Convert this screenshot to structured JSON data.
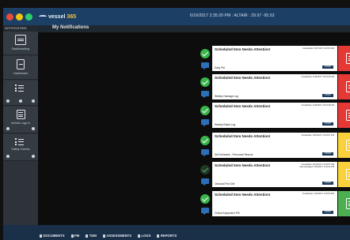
{
  "app": {
    "logo_prefix": "vessel",
    "logo_brand": "365",
    "status_line": "6/16/2017 2:35:20 PM : ALTAIR : 29.97 -95.53"
  },
  "window_controls": {
    "colors": [
      "#e74c3c",
      "#f1c40f",
      "#2ecc71"
    ]
  },
  "sidebar": {
    "header": "NOTIFICATIONS",
    "items": [
      {
        "label": "Dashboarding"
      },
      {
        "label": "Dashboard"
      },
      {
        "label": ""
      },
      {
        "label": "Vehicle Logs In"
      },
      {
        "label": "Safety Checks"
      }
    ]
  },
  "page": {
    "title": "My Notifications"
  },
  "notifications": [
    {
      "title": "Scheduled Item Needs Attention!",
      "meta1": "CreateDate: 5/27/2017 9:22:06 AM",
      "meta2": "",
      "item": "Daily PM",
      "button": "START",
      "color": "#e53935",
      "state": "done"
    },
    {
      "title": "Scheduled Item Needs Attention!",
      "meta1": "CreateDate: 6/16/2017 10:15:08 AM",
      "meta2": "",
      "item": "Weekly Garbage Log",
      "button": "START",
      "color": "#e53935",
      "state": "done"
    },
    {
      "title": "Scheduled Item Needs Attention!",
      "meta1": "CreateDate: 6/16/2017 10:15:08 AM",
      "meta2": "",
      "item": "Weekly Radar Log",
      "button": "START",
      "color": "#e53935",
      "state": "done"
    },
    {
      "title": "Scheduled Item Needs Attention!",
      "meta1": "CreateDate: 6/16/2017 12:00:07 PM",
      "meta2": "",
      "item": "Drill Schedule - Personnel Rescue",
      "button": "START",
      "color": "#f9d13c",
      "state": "done"
    },
    {
      "title": "Scheduled Item Needs Attention!",
      "meta1": "CreateDate: 6/16/2017 12:00:07 PM",
      "meta2": "Acknowledged: 6/16/2017 2:29:34 PM",
      "item": "Onboard Fire Drill",
      "button": "START",
      "color": "#f9d13c",
      "state": "pending"
    },
    {
      "title": "Scheduled Item Needs Attention!",
      "meta1": "CreateDate: 6/16/2017 2:29:50 PM",
      "meta2": "",
      "item": "Critical Equipment PM",
      "button": "START",
      "color": "#4caf50",
      "state": "done"
    }
  ],
  "footer_tabs": [
    {
      "label": "DOCUMENTS"
    },
    {
      "label": "PM"
    },
    {
      "label": "TDM"
    },
    {
      "label": "ASSESSMENTS"
    },
    {
      "label": "LOGS"
    },
    {
      "label": "REPORTS"
    }
  ]
}
